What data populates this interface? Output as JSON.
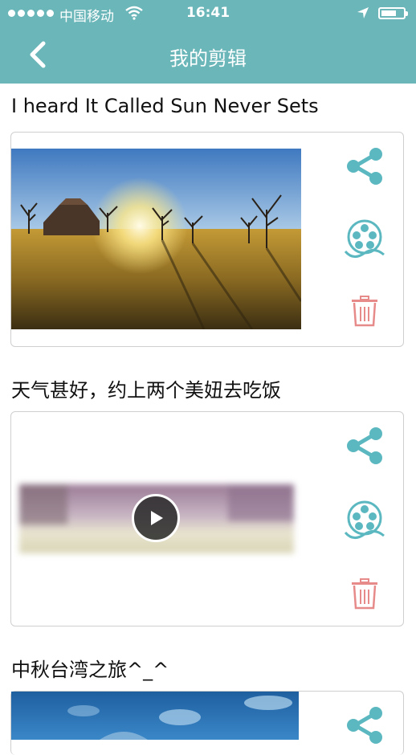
{
  "status_bar": {
    "carrier": "中国移动",
    "time": "16:41"
  },
  "nav": {
    "title": "我的剪辑",
    "back_icon": "chevron-left-icon"
  },
  "colors": {
    "header": "#6bb6b9",
    "accent": "#5cb8c0",
    "delete": "#e78a8a"
  },
  "items": [
    {
      "title": "I heard It Called Sun Never Sets",
      "media_type": "image",
      "actions": [
        "share-icon",
        "film-reel-icon",
        "trash-icon"
      ]
    },
    {
      "title": "天气甚好，约上两个美妞去吃饭",
      "media_type": "video",
      "actions": [
        "share-icon",
        "film-reel-icon",
        "trash-icon"
      ]
    },
    {
      "title": "中秋台湾之旅^_^",
      "media_type": "image",
      "actions": [
        "share-icon"
      ]
    }
  ]
}
